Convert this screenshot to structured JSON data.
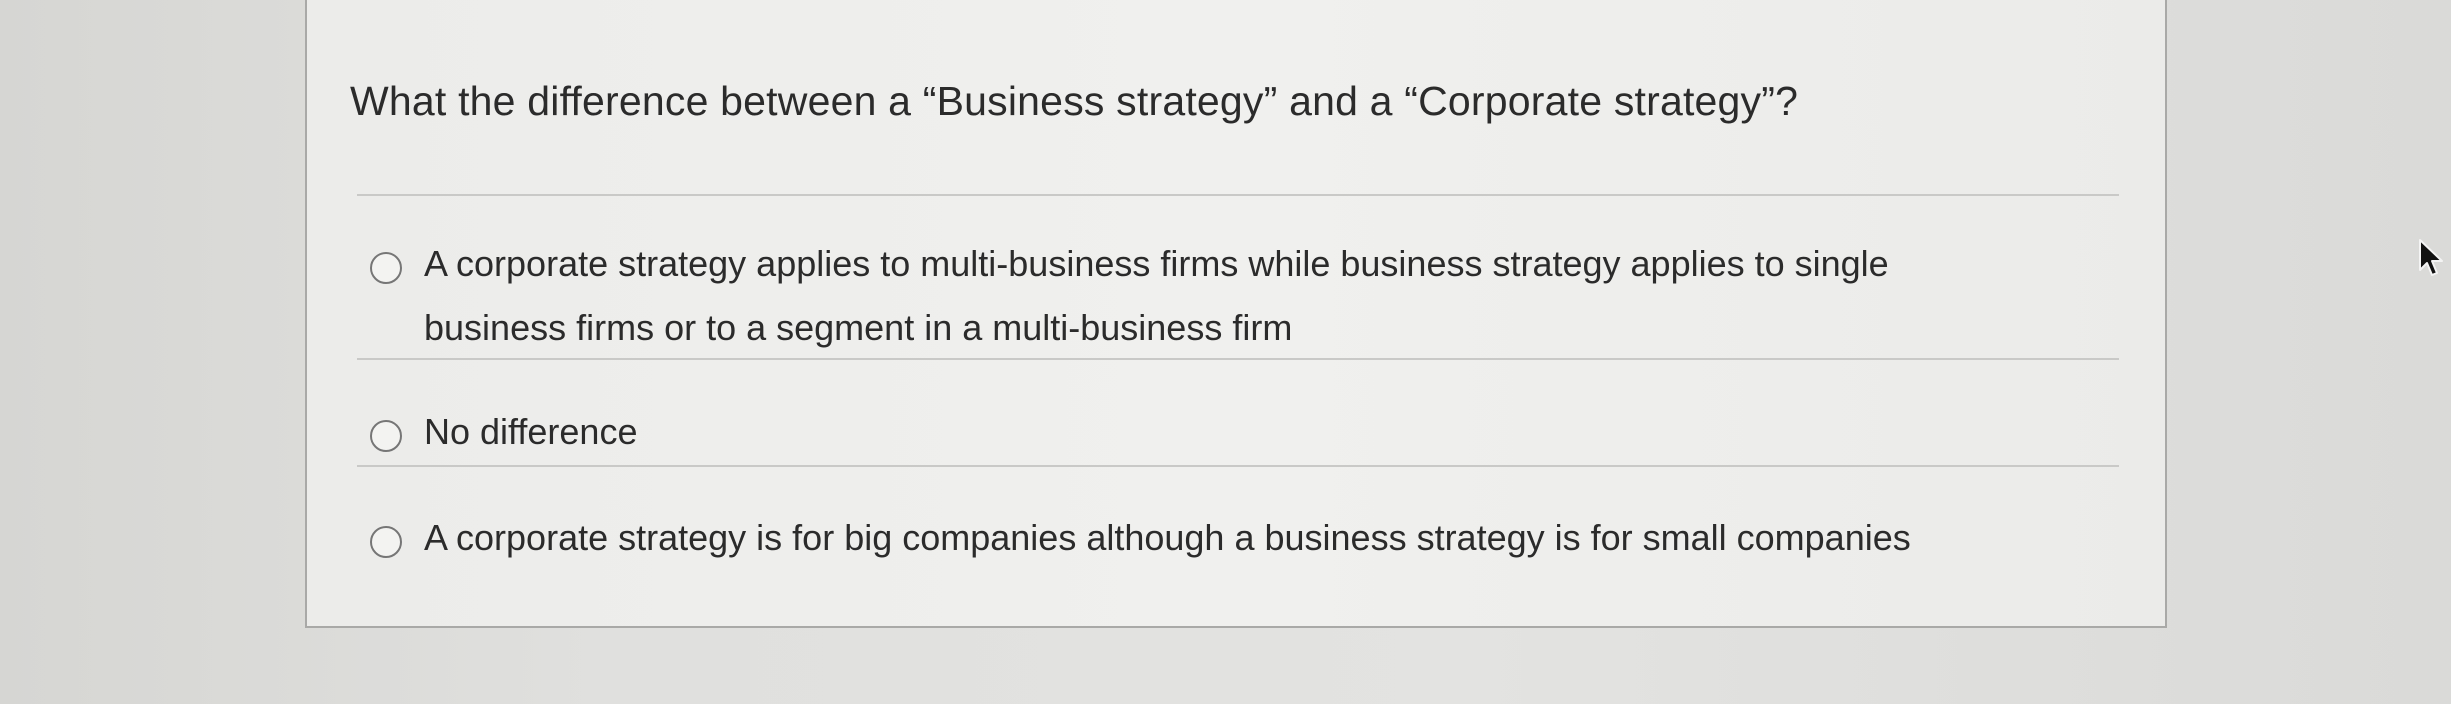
{
  "question": {
    "text": "What the difference between a “Business strategy” and a “Corporate strategy”?"
  },
  "options": [
    {
      "label": "A corporate strategy applies to multi-business firms while business strategy applies to single business firms or to a segment in a multi-business firm",
      "selected": false
    },
    {
      "label": "No difference",
      "selected": false
    },
    {
      "label": "A corporate strategy is for big companies although a business strategy is for small companies",
      "selected": false
    }
  ],
  "colors": {
    "background": "#e0e0de",
    "card": "#efefed",
    "card_border": "#a9a9a7",
    "text": "#2b2b2b",
    "radio_border": "#767676"
  },
  "icons": {
    "cursor": "mouse-pointer-icon",
    "radio": "radio-button-unselected-icon"
  }
}
